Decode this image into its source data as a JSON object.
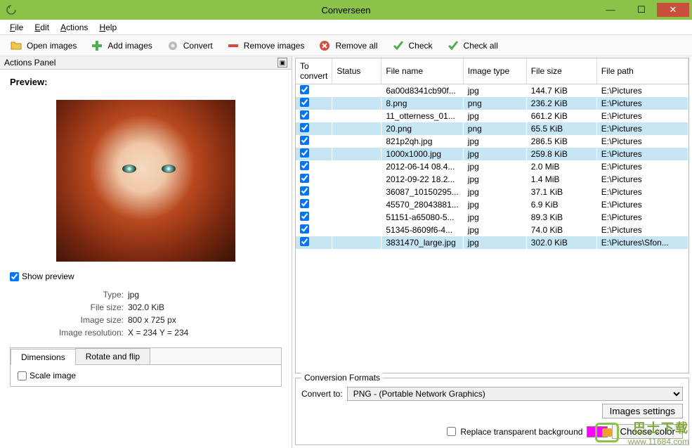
{
  "window": {
    "title": "Converseen"
  },
  "menu": {
    "file": "File",
    "edit": "Edit",
    "actions": "Actions",
    "help": "Help"
  },
  "toolbar": {
    "open": "Open images",
    "add": "Add images",
    "convert": "Convert",
    "remove": "Remove images",
    "remove_all": "Remove all",
    "check": "Check",
    "check_all": "Check all"
  },
  "actions_panel": {
    "title": "Actions Panel",
    "preview_label": "Preview:",
    "show_preview": "Show preview",
    "show_preview_checked": true,
    "info": {
      "type_label": "Type:",
      "type_value": "jpg",
      "filesize_label": "File size:",
      "filesize_value": "302.0 KiB",
      "imagesize_label": "Image size:",
      "imagesize_value": "800 x 725 px",
      "resolution_label": "Image resolution:",
      "resolution_value": "X = 234 Y = 234"
    },
    "tabs": {
      "dimensions": "Dimensions",
      "rotate": "Rotate and flip"
    },
    "scale_image": "Scale image",
    "scale_checked": false
  },
  "list": {
    "headers": {
      "to_convert": "To convert",
      "status": "Status",
      "file_name": "File name",
      "image_type": "Image type",
      "file_size": "File size",
      "file_path": "File path"
    },
    "rows": [
      {
        "checked": true,
        "status": "",
        "name": "6a00d8341cb90f...",
        "type": "jpg",
        "size": "144.7 KiB",
        "path": "E:\\Pictures",
        "hl": false
      },
      {
        "checked": true,
        "status": "",
        "name": "8.png",
        "type": "png",
        "size": "236.2 KiB",
        "path": "E:\\Pictures",
        "hl": true
      },
      {
        "checked": true,
        "status": "",
        "name": "11_otterness_01...",
        "type": "jpg",
        "size": "661.2 KiB",
        "path": "E:\\Pictures",
        "hl": false
      },
      {
        "checked": true,
        "status": "",
        "name": "20.png",
        "type": "png",
        "size": "65.5 KiB",
        "path": "E:\\Pictures",
        "hl": true
      },
      {
        "checked": true,
        "status": "",
        "name": "821p2qh.jpg",
        "type": "jpg",
        "size": "286.5 KiB",
        "path": "E:\\Pictures",
        "hl": false
      },
      {
        "checked": true,
        "status": "",
        "name": "1000x1000.jpg",
        "type": "jpg",
        "size": "259.8 KiB",
        "path": "E:\\Pictures",
        "hl": true
      },
      {
        "checked": true,
        "status": "",
        "name": "2012-06-14 08.4...",
        "type": "jpg",
        "size": "2.0 MiB",
        "path": "E:\\Pictures",
        "hl": false
      },
      {
        "checked": true,
        "status": "",
        "name": "2012-09-22 18.2...",
        "type": "jpg",
        "size": "1.4 MiB",
        "path": "E:\\Pictures",
        "hl": false
      },
      {
        "checked": true,
        "status": "",
        "name": "36087_10150295...",
        "type": "jpg",
        "size": "37.1 KiB",
        "path": "E:\\Pictures",
        "hl": false
      },
      {
        "checked": true,
        "status": "",
        "name": "45570_28043881...",
        "type": "jpg",
        "size": "6.9 KiB",
        "path": "E:\\Pictures",
        "hl": false
      },
      {
        "checked": true,
        "status": "",
        "name": "51151-a65080-5...",
        "type": "jpg",
        "size": "89.3 KiB",
        "path": "E:\\Pictures",
        "hl": false
      },
      {
        "checked": true,
        "status": "",
        "name": "51345-8609f6-4...",
        "type": "jpg",
        "size": "74.0 KiB",
        "path": "E:\\Pictures",
        "hl": false
      },
      {
        "checked": true,
        "status": "",
        "name": "3831470_large.jpg",
        "type": "jpg",
        "size": "302.0 KiB",
        "path": "E:\\Pictures\\Sfon...",
        "hl": true
      }
    ]
  },
  "conversion": {
    "legend": "Conversion Formats",
    "convert_to_label": "Convert to:",
    "convert_to_value": "PNG - (Portable Network Graphics)",
    "images_settings": "Images settings",
    "replace_bg": "Replace transparent background",
    "replace_checked": false,
    "choose_color": "Choose color"
  },
  "watermark": {
    "cn": "巴士下载",
    "url": "www.11684.com"
  }
}
